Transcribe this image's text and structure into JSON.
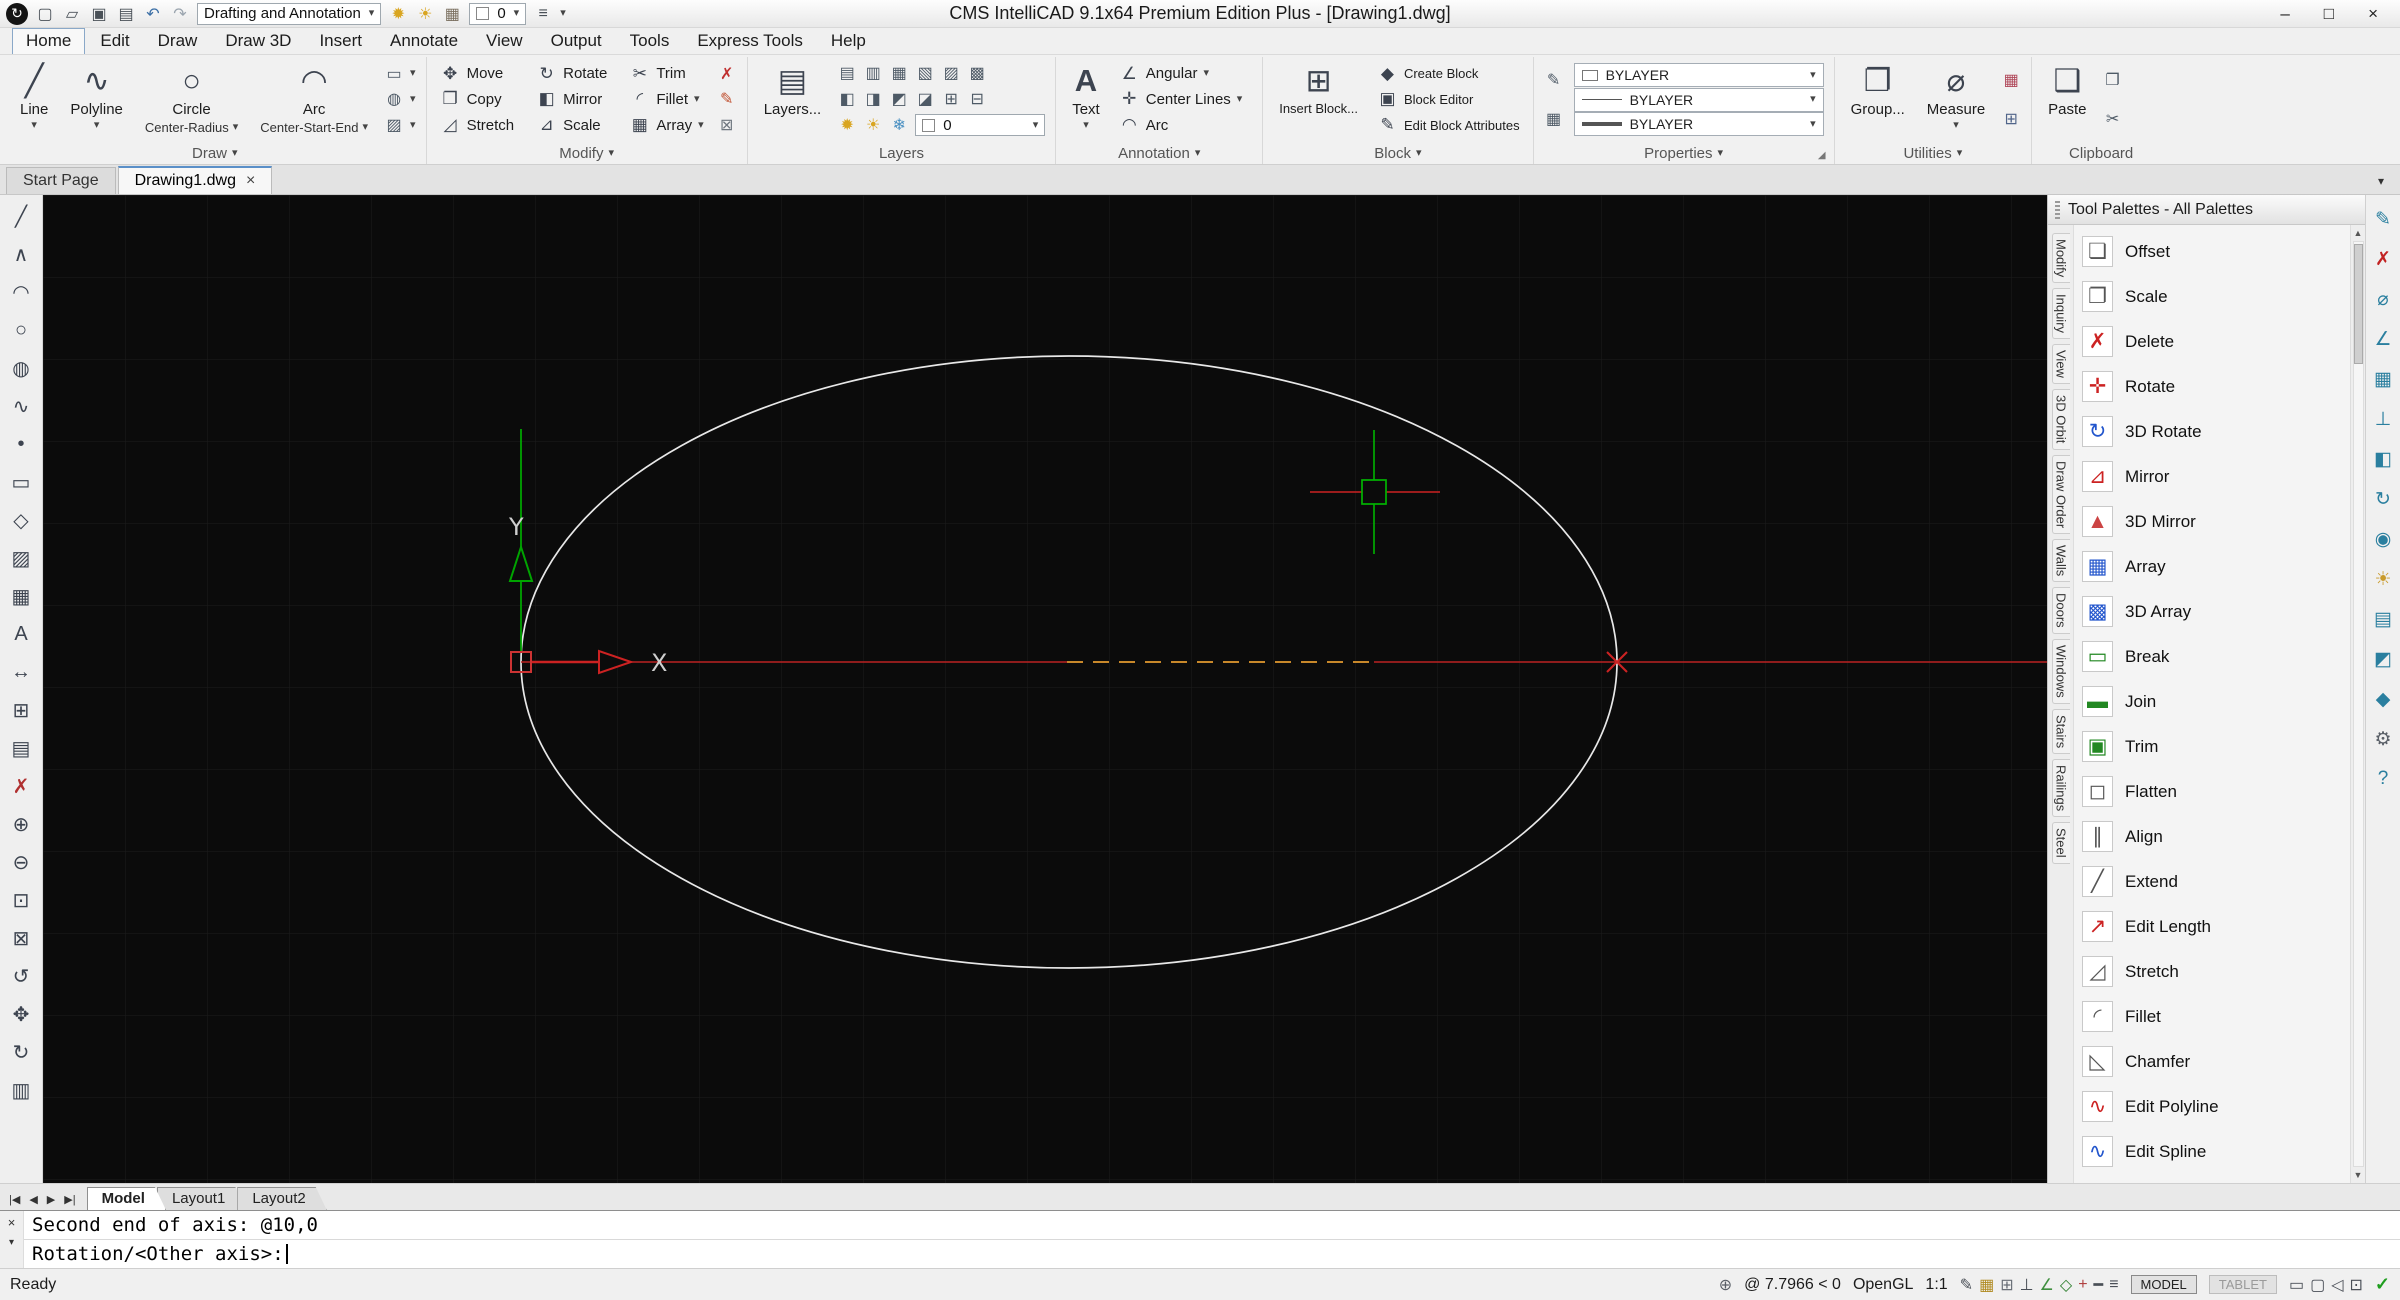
{
  "ui": {
    "caret": "▾",
    "close": "×",
    "minimize": "–",
    "maximize": "□",
    "scroll_up": "▲",
    "scroll_down": "▼",
    "launcher": "◢",
    "app_glyph": "↻"
  },
  "title_bar": {
    "title": "CMS IntelliCAD 9.1x64 Premium Edition Plus  - [Drawing1.dwg]",
    "workspace": "Drafting and Annotation",
    "layer_value": "0",
    "icons": [
      {
        "name": "new-file-icon",
        "glyph": "▢",
        "color": "#4a5158"
      },
      {
        "name": "open-file-icon",
        "glyph": "▱",
        "color": "#4a5158"
      },
      {
        "name": "save-icon",
        "glyph": "▣",
        "color": "#4a5158"
      },
      {
        "name": "print-icon",
        "glyph": "▤",
        "color": "#4a5158"
      },
      {
        "name": "undo-icon",
        "glyph": "↶",
        "color": "#3a6ea5"
      },
      {
        "name": "redo-icon",
        "glyph": "↷",
        "color": "#9aa4ae"
      }
    ],
    "icons2": [
      {
        "name": "bulb-icon",
        "glyph": "✹",
        "color": "#d9a520"
      },
      {
        "name": "sun-icon",
        "glyph": "☀",
        "color": "#d9a520"
      },
      {
        "name": "swatch-grid-icon",
        "glyph": "▦",
        "color": "#7a6f5f"
      }
    ],
    "customize_glyph": "≡"
  },
  "menu_bar": {
    "items": [
      "Home",
      "Edit",
      "Draw",
      "Draw 3D",
      "Insert",
      "Annotate",
      "View",
      "Output",
      "Tools",
      "Express Tools",
      "Help"
    ]
  },
  "ribbon": {
    "draw": {
      "footer": "Draw",
      "line": {
        "label": "Line",
        "glyph": "╱"
      },
      "polyline": {
        "label": "Polyline",
        "glyph": "∿"
      },
      "circle": {
        "label": "Circle",
        "mode": "Center-Radius",
        "glyph": "○"
      },
      "arc": {
        "label": "Arc",
        "mode": "Center-Start-End",
        "glyph": "◠"
      },
      "extras": [
        {
          "name": "rectangle-icon",
          "glyph": "▭",
          "caret": "▾"
        },
        {
          "name": "ellipse-icon",
          "glyph": "◍",
          "caret": "▾"
        },
        {
          "name": "hatch-icon",
          "glyph": "▨",
          "caret": "▾"
        }
      ]
    },
    "modify": {
      "footer": "Modify",
      "items": [
        {
          "label": "Move",
          "glyph": "✥"
        },
        {
          "label": "Copy",
          "glyph": "❐"
        },
        {
          "label": "Stretch",
          "glyph": "◿"
        },
        {
          "label": "Rotate",
          "glyph": "↻"
        },
        {
          "label": "Mirror",
          "glyph": "◧"
        },
        {
          "label": "Scale",
          "glyph": "⊿"
        },
        {
          "label": "Trim",
          "glyph": "✂"
        },
        {
          "label": "Fillet",
          "glyph": "◜",
          "caret": "▾"
        },
        {
          "label": "Array",
          "glyph": "▦",
          "caret": "▾"
        }
      ],
      "extras": [
        {
          "name": "erase-icon",
          "glyph": "✗",
          "color": "#c03030"
        },
        {
          "name": "edit-icon",
          "glyph": "✎",
          "color": "#c05030"
        },
        {
          "name": "lock-icon",
          "glyph": "⊠",
          "color": "#707880"
        }
      ]
    },
    "layers": {
      "footer": "Layers",
      "button": "Layers...",
      "button_glyph": "▤",
      "combo_value": "0",
      "row1": [
        {
          "name": "layer-properties-icon",
          "glyph": "▤"
        },
        {
          "name": "layer-states-icon",
          "glyph": "▥"
        },
        {
          "name": "layer-off-icon",
          "glyph": "▦"
        },
        {
          "name": "layer-freeze-icon",
          "glyph": "▧"
        },
        {
          "name": "layer-lock-icon",
          "glyph": "▨"
        },
        {
          "name": "layer-match-icon",
          "glyph": "▩"
        }
      ],
      "row2": [
        {
          "name": "layer-previous-icon",
          "glyph": "◧"
        },
        {
          "name": "layer-isolate-icon",
          "glyph": "◨"
        },
        {
          "name": "layer-unisolate-icon",
          "glyph": "◩"
        },
        {
          "name": "layer-walk-icon",
          "glyph": "◪"
        },
        {
          "name": "layer-merge-icon",
          "glyph": "⊞"
        },
        {
          "name": "layer-delete-icon",
          "glyph": "⊟"
        }
      ],
      "row3icons": [
        {
          "name": "layer-on-bulb-icon",
          "glyph": "✹",
          "color": "#d9a520"
        },
        {
          "name": "layer-thaw-sun-icon",
          "glyph": "☀",
          "color": "#d9a520"
        },
        {
          "name": "layer-freeze-snowflake-icon",
          "glyph": "❄",
          "color": "#4a90c2"
        }
      ]
    },
    "annotation": {
      "footer": "Annotation",
      "text": {
        "label": "Text",
        "glyph": "A"
      },
      "items": [
        {
          "label": "Angular",
          "glyph": "∠",
          "caret": "▾"
        },
        {
          "label": "Center Lines",
          "glyph": "✛",
          "caret": "▾"
        },
        {
          "label": "Arc",
          "glyph": "◠"
        }
      ]
    },
    "block": {
      "footer": "Block",
      "insert": {
        "label": "Insert Block...",
        "glyph": "⊞"
      },
      "items": [
        {
          "label": "Create Block",
          "glyph": "◆"
        },
        {
          "label": "Block Editor",
          "glyph": "▣"
        },
        {
          "label": "Edit Block Attributes",
          "glyph": "✎"
        }
      ]
    },
    "properties": {
      "footer": "Properties",
      "combos": [
        "BYLAYER",
        "BYLAYER",
        "BYLAYER"
      ],
      "side_icons": [
        {
          "name": "match-properties-icon",
          "glyph": "✎"
        },
        {
          "name": "color-swatches-icon",
          "glyph": "▦"
        }
      ]
    },
    "utilities": {
      "footer": "Utilities",
      "group": {
        "label": "Group...",
        "glyph": "❐"
      },
      "measure": {
        "label": "Measure",
        "glyph": "⌀",
        "caret": "▾"
      },
      "extras": [
        {
          "name": "quick-select-icon",
          "glyph": "▦",
          "color": "#b0485a"
        },
        {
          "name": "calculator-icon",
          "glyph": "⊞",
          "color": "#51658a"
        }
      ]
    },
    "clipboard": {
      "footer": "Clipboard",
      "paste": {
        "label": "Paste",
        "glyph": "❑"
      },
      "extras": [
        {
          "name": "copy-clip-icon",
          "glyph": "❐"
        },
        {
          "name": "cut-icon",
          "glyph": "✂"
        }
      ]
    }
  },
  "doc_tabs": {
    "start_page": "Start Page",
    "drawing": "Drawing1.dwg"
  },
  "left_toolbar": [
    {
      "name": "line-tool-icon",
      "glyph": "╱"
    },
    {
      "name": "polyline-tool-icon",
      "glyph": "∧"
    },
    {
      "name": "arc-tool-icon",
      "glyph": "◠"
    },
    {
      "name": "circle-tool-icon",
      "glyph": "○"
    },
    {
      "name": "ellipse-tool-icon",
      "glyph": "◍"
    },
    {
      "name": "spline-tool-icon",
      "glyph": "∿"
    },
    {
      "name": "point-tool-icon",
      "glyph": "•"
    },
    {
      "name": "rectangle-tool-icon",
      "glyph": "▭"
    },
    {
      "name": "polygon-tool-icon",
      "glyph": "◇"
    },
    {
      "name": "hatch-tool-icon",
      "glyph": "▨"
    },
    {
      "name": "region-tool-icon",
      "glyph": "▦"
    },
    {
      "name": "text-tool-icon",
      "glyph": "A"
    },
    {
      "name": "dimension-tool-icon",
      "glyph": "↔"
    },
    {
      "name": "block-insert-tool-icon",
      "glyph": "⊞"
    },
    {
      "name": "table-tool-icon",
      "glyph": "▤"
    },
    {
      "name": "erase-tool-icon",
      "glyph": "✗",
      "color": "#b03030"
    },
    {
      "name": "zoom-in-tool-icon",
      "glyph": "⊕"
    },
    {
      "name": "zoom-out-tool-icon",
      "glyph": "⊖"
    },
    {
      "name": "zoom-window-tool-icon",
      "glyph": "⊡"
    },
    {
      "name": "zoom-extents-tool-icon",
      "glyph": "⊠"
    },
    {
      "name": "zoom-previous-tool-icon",
      "glyph": "↺"
    },
    {
      "name": "pan-tool-icon",
      "glyph": "✥"
    },
    {
      "name": "orbit-tool-icon",
      "glyph": "↻"
    },
    {
      "name": "print-tool-icon",
      "glyph": "▥"
    }
  ],
  "canvas": {
    "x_label": "X",
    "y_label": "Y"
  },
  "tool_palette": {
    "title": "Tool Palettes - All Palettes",
    "tabs": [
      "Modify",
      "Inquiry",
      "View",
      "3D Orbit",
      "Draw Order",
      "Walls",
      "Doors",
      "Windows",
      "Stairs",
      "Railings",
      "Steel"
    ],
    "items": [
      {
        "label": "Offset",
        "glyph": "❏",
        "color": "#555555"
      },
      {
        "label": "Scale",
        "glyph": "❐",
        "color": "#555555"
      },
      {
        "label": "Delete",
        "glyph": "✗",
        "color": "#cc2222"
      },
      {
        "label": "Rotate",
        "glyph": "✛",
        "color": "#cc2222"
      },
      {
        "label": "3D Rotate",
        "glyph": "↻",
        "color": "#2255cc"
      },
      {
        "label": "Mirror",
        "glyph": "⊿",
        "color": "#cc2222"
      },
      {
        "label": "3D Mirror",
        "glyph": "▲",
        "color": "#cc4444"
      },
      {
        "label": "Array",
        "glyph": "▦",
        "color": "#2255cc"
      },
      {
        "label": "3D Array",
        "glyph": "▩",
        "color": "#2255cc"
      },
      {
        "label": "Break",
        "glyph": "▭",
        "color": "#228822"
      },
      {
        "label": "Join",
        "glyph": "▬",
        "color": "#228822"
      },
      {
        "label": "Trim",
        "glyph": "▣",
        "color": "#228822"
      },
      {
        "label": "Flatten",
        "glyph": "◻",
        "color": "#555555"
      },
      {
        "label": "Align",
        "glyph": "∥",
        "color": "#555555"
      },
      {
        "label": "Extend",
        "glyph": "╱",
        "color": "#555555"
      },
      {
        "label": "Edit Length",
        "glyph": "↗",
        "color": "#cc2222"
      },
      {
        "label": "Stretch",
        "glyph": "◿",
        "color": "#555555"
      },
      {
        "label": "Fillet",
        "glyph": "◜",
        "color": "#555555"
      },
      {
        "label": "Chamfer",
        "glyph": "◺",
        "color": "#555555"
      },
      {
        "label": "Edit Polyline",
        "glyph": "∿",
        "color": "#cc2222"
      },
      {
        "label": "Edit Spline",
        "glyph": "∿",
        "color": "#2255cc"
      }
    ]
  },
  "right_strip": [
    {
      "name": "modify-palette-icon",
      "glyph": "✎",
      "color": "#2a7f9f"
    },
    {
      "name": "delete-icon",
      "glyph": "✗",
      "color": "#c22222"
    },
    {
      "name": "measure-icon",
      "glyph": "⌀",
      "color": "#2a7f9f"
    },
    {
      "name": "angle-icon",
      "glyph": "∠",
      "color": "#2a7f9f"
    },
    {
      "name": "grid-icon",
      "glyph": "▦",
      "color": "#2a7f9f"
    },
    {
      "name": "ucs-icon",
      "glyph": "⊥",
      "color": "#2a7f9f"
    },
    {
      "name": "view-icon",
      "glyph": "◧",
      "color": "#2a7f9f"
    },
    {
      "name": "orbit-icon",
      "glyph": "↻",
      "color": "#2a7f9f"
    },
    {
      "name": "camera-icon",
      "glyph": "◉",
      "color": "#2a7f9f"
    },
    {
      "name": "sun-icon",
      "glyph": "☀",
      "color": "#c99a2a"
    },
    {
      "name": "layers-icon",
      "glyph": "▤",
      "color": "#2a7f9f"
    },
    {
      "name": "render-icon",
      "glyph": "◩",
      "color": "#2a7f9f"
    },
    {
      "name": "materials-icon",
      "glyph": "◆",
      "color": "#2a7f9f"
    },
    {
      "name": "settings-icon",
      "glyph": "⚙",
      "color": "#5a6068"
    },
    {
      "name": "help-icon",
      "glyph": "?",
      "color": "#2a7f9f"
    }
  ],
  "layout_nav": [
    "|◀",
    "◀",
    "▶",
    "▶|"
  ],
  "layout_tabs": [
    "Model",
    "Layout1",
    "Layout2"
  ],
  "command": {
    "line1": "Second end of axis: @10,0",
    "line2": "Rotation/<Other axis>:"
  },
  "status_bar": {
    "ready": "Ready",
    "coords": "@ 7.7966 < 0",
    "renderer": "OpenGL",
    "scale": "1:1",
    "model": "MODEL",
    "tablet": "TABLET",
    "pre_coords": [
      {
        "name": "position-icon",
        "glyph": "⊕",
        "color": "#5a6068"
      }
    ],
    "toggles": [
      {
        "name": "annotate-pencil-icon",
        "glyph": "✎",
        "color": "#4a4f57"
      },
      {
        "name": "grid-toggle-icon",
        "glyph": "▦",
        "color": "#b08a20"
      },
      {
        "name": "snap-toggle-icon",
        "glyph": "⊞",
        "color": "#6a6f77"
      },
      {
        "name": "ortho-toggle-icon",
        "glyph": "⊥",
        "color": "#4a4f57"
      },
      {
        "name": "polar-toggle-icon",
        "glyph": "∠",
        "color": "#3f8f3f"
      },
      {
        "name": "osnap-toggle-icon",
        "glyph": "◇",
        "color": "#2f7f2f"
      },
      {
        "name": "otrack-toggle-icon",
        "glyph": "+",
        "color": "#b04040"
      },
      {
        "name": "lineweight-toggle-icon",
        "glyph": "━",
        "color": "#4a4f57"
      },
      {
        "name": "dynamic-input-icon",
        "glyph": "≡",
        "color": "#4a4f57"
      }
    ],
    "right_icons": [
      {
        "name": "tablet-icon",
        "glyph": "▭",
        "color": "#4a4f57"
      },
      {
        "name": "monitor-icon",
        "glyph": "▢",
        "color": "#4a4f57"
      },
      {
        "name": "mouse-icon",
        "glyph": "◁",
        "color": "#4a4f57"
      },
      {
        "name": "clean-screen-icon",
        "glyph": "⊡",
        "color": "#4a4f57"
      }
    ],
    "check": "✓"
  }
}
